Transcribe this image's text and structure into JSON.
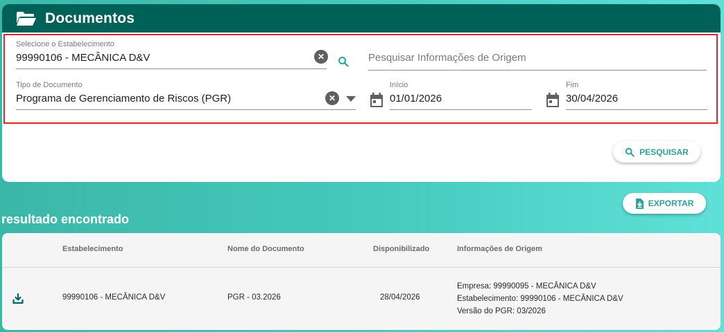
{
  "header": {
    "title": "Documentos",
    "icon": "folder-open-icon"
  },
  "filters": {
    "establishment": {
      "label": "Selecione o Estabelecimento",
      "value": "99990106 - MECÂNICA D&V"
    },
    "origin_search": {
      "placeholder": "Pesquisar Informações de Origem"
    },
    "document_type": {
      "label": "Tipo de Documento",
      "value": "Programa de Gerenciamento de Riscos (PGR)"
    },
    "start": {
      "label": "Início",
      "value": "01/01/2026"
    },
    "end": {
      "label": "Fim",
      "value": "30/04/2026"
    }
  },
  "actions": {
    "search_label": "PESQUISAR",
    "export_label": "EXPORTAR"
  },
  "results": {
    "title": "resultado encontrado",
    "columns": [
      "Estabelecimento",
      "Nome do Documento",
      "Disponibilizado",
      "Informações de Origem"
    ],
    "rows": [
      {
        "establishment": "99990106 - MECÂNICA D&V",
        "document_name": "PGR - 03.2026",
        "available": "28/04/2026",
        "origin": [
          "Empresa: 99990095 - MECÂNICA D&V",
          "Estabelecimento: 99990106 - MECÂNICA D&V",
          "Versão do PGR: 03/2026"
        ]
      }
    ]
  },
  "colors": {
    "header": "#006159",
    "accent": "#2ba39a",
    "highlight_border": "#e0262b"
  }
}
